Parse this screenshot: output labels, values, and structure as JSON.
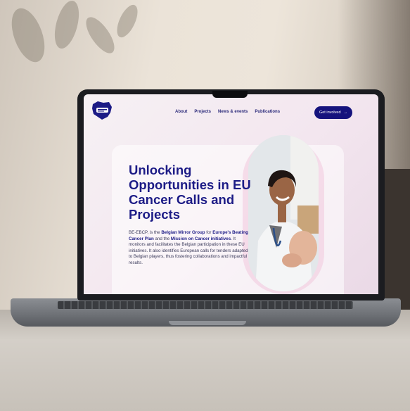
{
  "website": {
    "logo_text": "BE-EBCP",
    "nav": [
      {
        "label": "About"
      },
      {
        "label": "Projects"
      },
      {
        "label": "News & events"
      },
      {
        "label": "Publications"
      }
    ],
    "cta_label": "Get involved",
    "cta_arrow": "→",
    "headline": "Unlocking Opportunities in EU Cancer Calls and Projects",
    "body": {
      "p1": "BE-EBCP, is the ",
      "b1": "Belgian Mirror Group",
      "p2": " for ",
      "b2": "Europe's Beating Cancer Plan",
      "p3": " and the ",
      "b3": "Mission on Cancer initiatives",
      "p4": ". It monitors and facilitates the Belgian participation in these EU initiatives. It also identifies European calls for tenders adapted to Belgian players, thus fostering collaborations and impactful results."
    }
  },
  "colors": {
    "brand": "#1c1b86",
    "cta_bg": "#15137d"
  }
}
